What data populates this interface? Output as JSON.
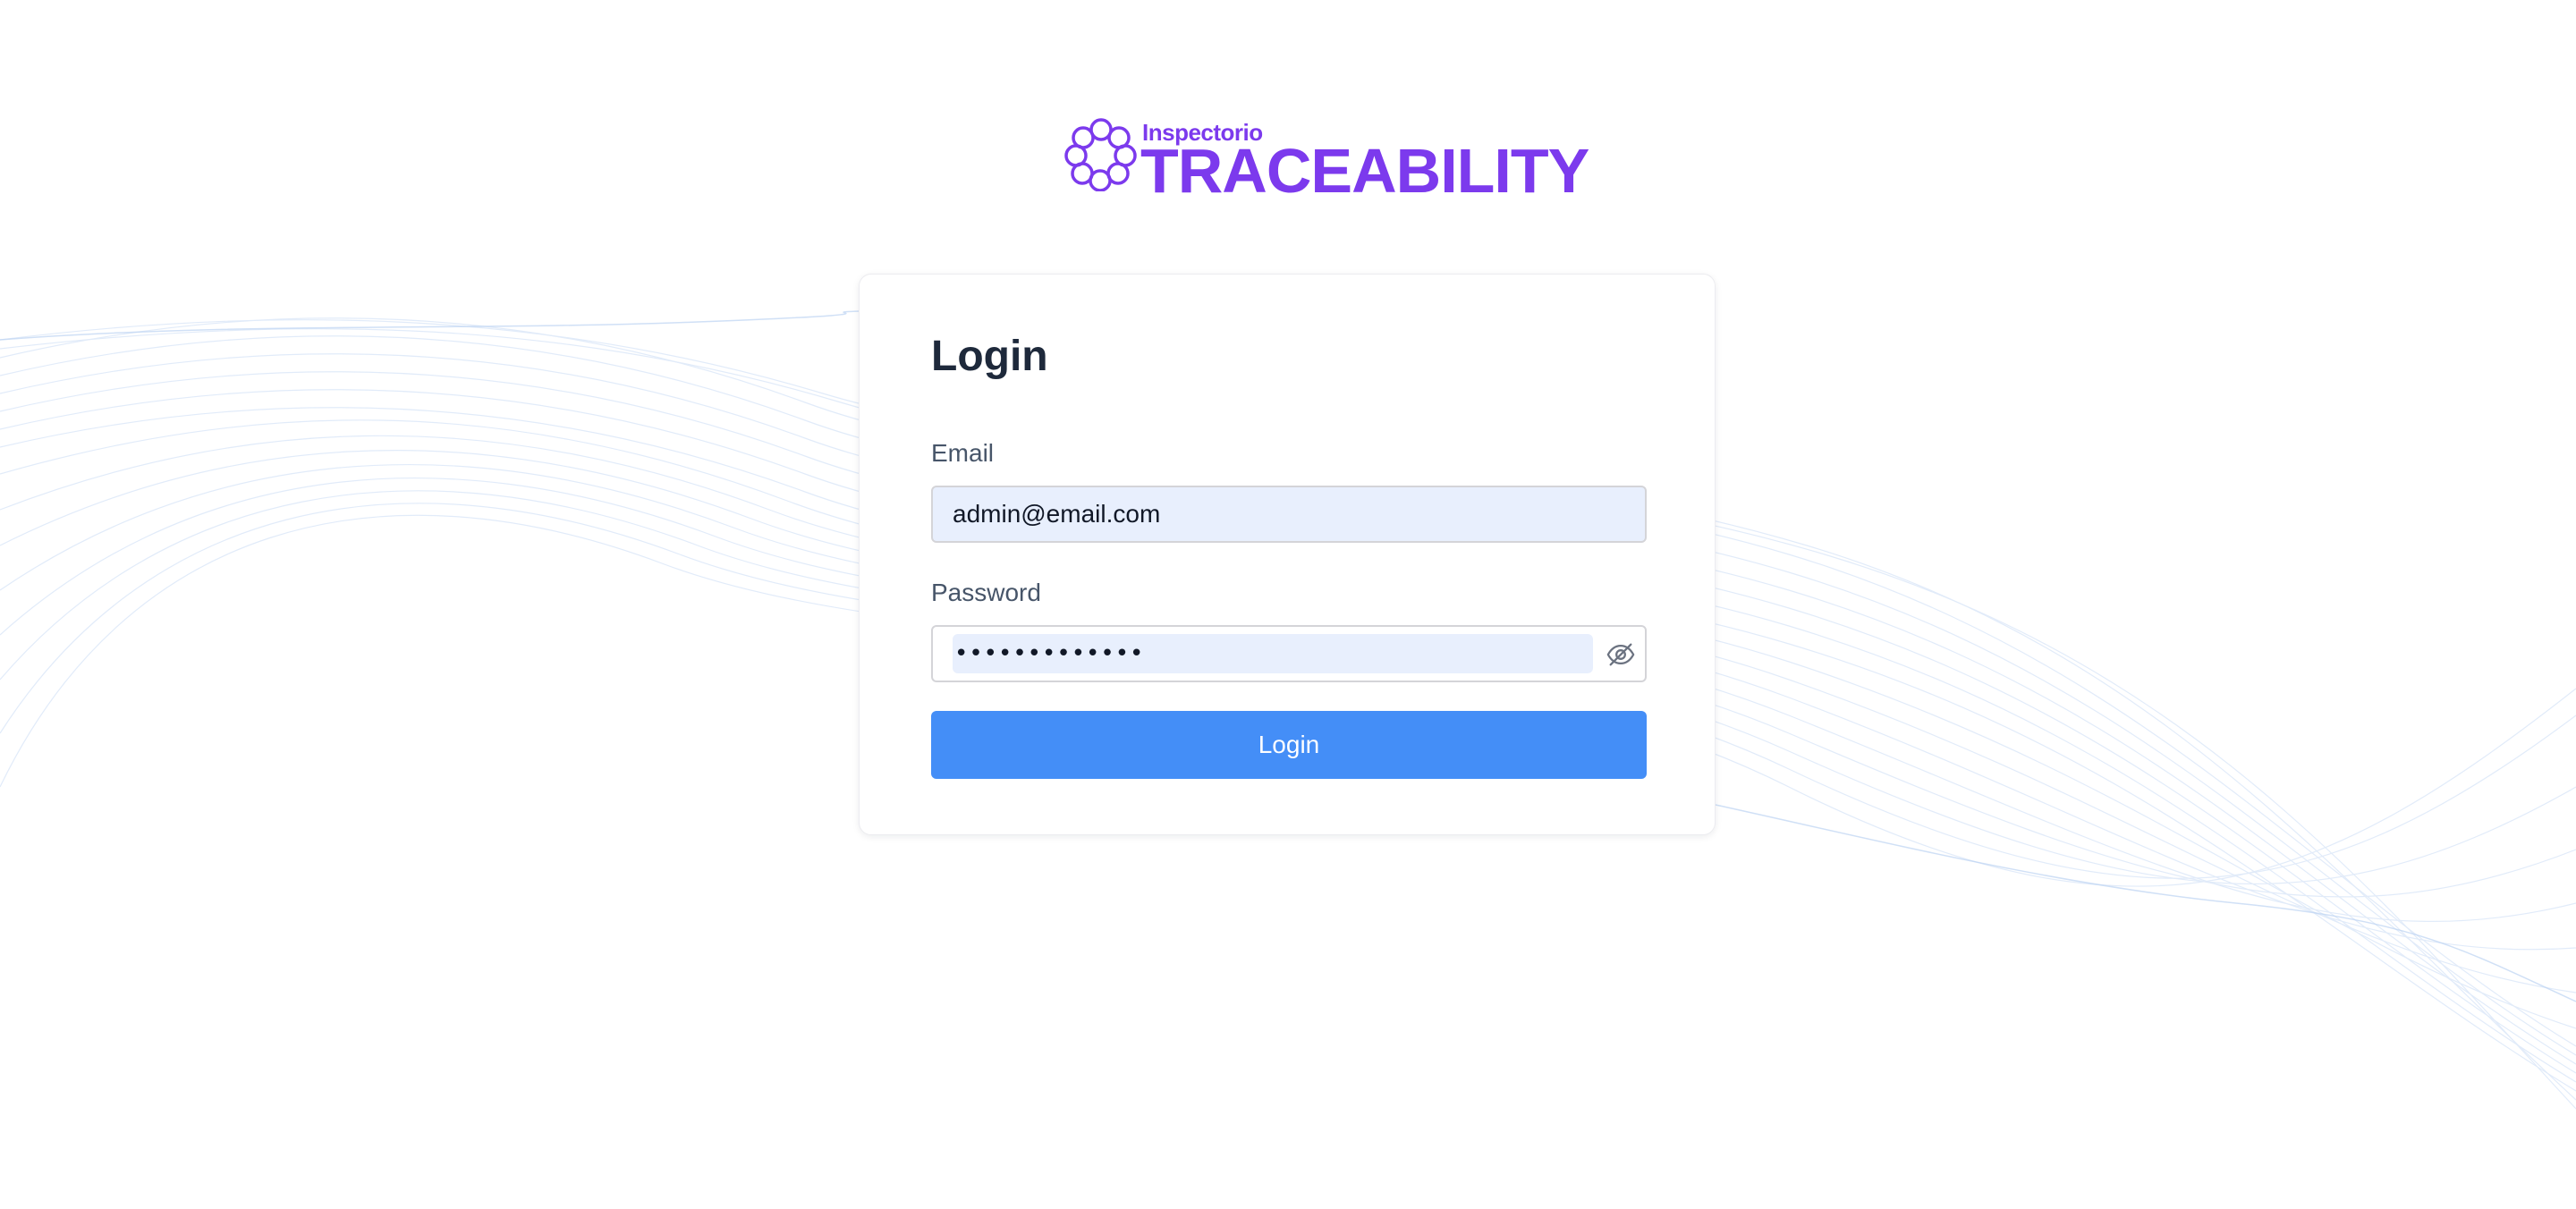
{
  "brand": {
    "sub_label": "Inspectorio",
    "main_label": "TRACEABILITY",
    "color": "#7c3aed"
  },
  "login_form": {
    "title": "Login",
    "email_label": "Email",
    "email_value": "admin@email.com",
    "password_label": "Password",
    "password_value": "•••••••••••••",
    "password_toggle_icon": "eye-off-icon",
    "submit_label": "Login",
    "submit_color": "#448ef7"
  }
}
